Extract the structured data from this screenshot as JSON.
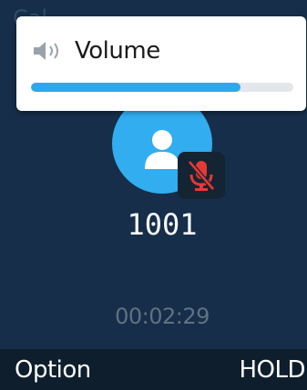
{
  "status_bar": {
    "partial_text": "Cal"
  },
  "volume_popup": {
    "icon": "speaker-volume-icon",
    "label": "Volume",
    "level": 0.8
  },
  "call": {
    "avatar_icon": "person-icon",
    "mute_icon": "microphone-muted-icon",
    "caller_number": "1001",
    "duration": "00:02:29"
  },
  "softkeys": {
    "left_label": "Option",
    "right_label": "HOLD"
  },
  "colors": {
    "background": "#162e49",
    "accent": "#2aa9ee",
    "mute": "#e53935",
    "softkey_bar": "#0f1e2d"
  }
}
